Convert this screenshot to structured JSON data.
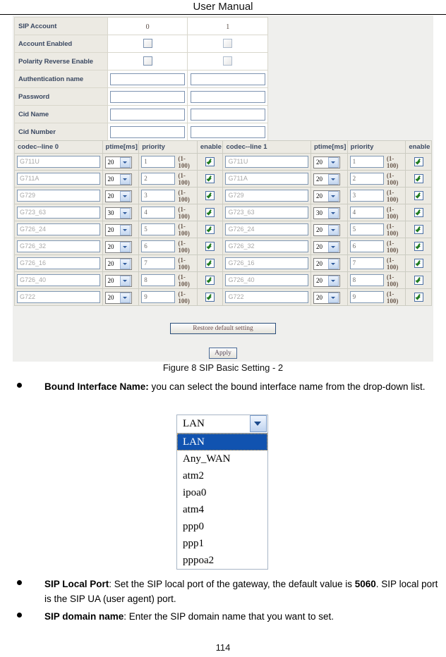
{
  "header": {
    "title": "User Manual"
  },
  "page": {
    "number": "114"
  },
  "figure": {
    "caption": "Figure 8 SIP Basic Setting - 2"
  },
  "account_table": {
    "rows": [
      {
        "label": "SIP Account",
        "type": "text",
        "col0": "0",
        "col1": "1"
      },
      {
        "label": "Account Enabled",
        "type": "checkbox",
        "col0": "",
        "col1": ""
      },
      {
        "label": "Polarity Reverse Enable",
        "type": "checkbox",
        "col0": "",
        "col1": ""
      },
      {
        "label": "Authentication name",
        "type": "input",
        "col0": "",
        "col1": ""
      },
      {
        "label": "Password",
        "type": "input",
        "col0": "",
        "col1": ""
      },
      {
        "label": "Cid Name",
        "type": "input",
        "col0": "",
        "col1": ""
      },
      {
        "label": "Cid Number",
        "type": "input",
        "col0": "",
        "col1": ""
      }
    ]
  },
  "codec_table": {
    "headers_line0": {
      "codec": "codec--line 0",
      "ptime": "ptime[ms]",
      "priority": "priority",
      "enable": "enable"
    },
    "headers_line1": {
      "codec": "codec--line 1",
      "ptime": "ptime[ms]",
      "priority": "priority",
      "enable": "enable"
    },
    "range_hint": "(1-100)",
    "rows": [
      {
        "codec": "G711U",
        "ptime": "20",
        "priority": "1",
        "enabled": true
      },
      {
        "codec": "G711A",
        "ptime": "20",
        "priority": "2",
        "enabled": true
      },
      {
        "codec": "G729",
        "ptime": "20",
        "priority": "3",
        "enabled": true
      },
      {
        "codec": "G723_63",
        "ptime": "30",
        "priority": "4",
        "enabled": true
      },
      {
        "codec": "G726_24",
        "ptime": "20",
        "priority": "5",
        "enabled": true
      },
      {
        "codec": "G726_32",
        "ptime": "20",
        "priority": "6",
        "enabled": true
      },
      {
        "codec": "G726_16",
        "ptime": "20",
        "priority": "7",
        "enabled": true
      },
      {
        "codec": "G726_40",
        "ptime": "20",
        "priority": "8",
        "enabled": true
      },
      {
        "codec": "G722",
        "ptime": "20",
        "priority": "9",
        "enabled": true
      }
    ]
  },
  "buttons": {
    "restore": "Restore default setting",
    "apply": "Apply"
  },
  "bullets": [
    {
      "term": "Bound Interface Name:",
      "rest": " you can select the bound interface name from the drop-down list."
    },
    {
      "term": "SIP Local Port",
      "rest": ": Set the SIP local port of the gateway, the default value is ",
      "strong": "5060",
      "tail": ". SIP local port is the SIP UA (user agent) port."
    },
    {
      "term": "SIP domain name",
      "rest": ": Enter the SIP domain name that you want to set."
    }
  ],
  "dropdown": {
    "selected": "LAN",
    "options": [
      "LAN",
      "Any_WAN",
      "atm2",
      "ipoa0",
      "atm4",
      "ppp0",
      "ppp1",
      "pppoa2"
    ]
  },
  "colors": {
    "panel_bg": "#efefed",
    "label_text": "#3c4a63",
    "highlight": "#1153b0",
    "check_green": "#1f7a1f"
  }
}
